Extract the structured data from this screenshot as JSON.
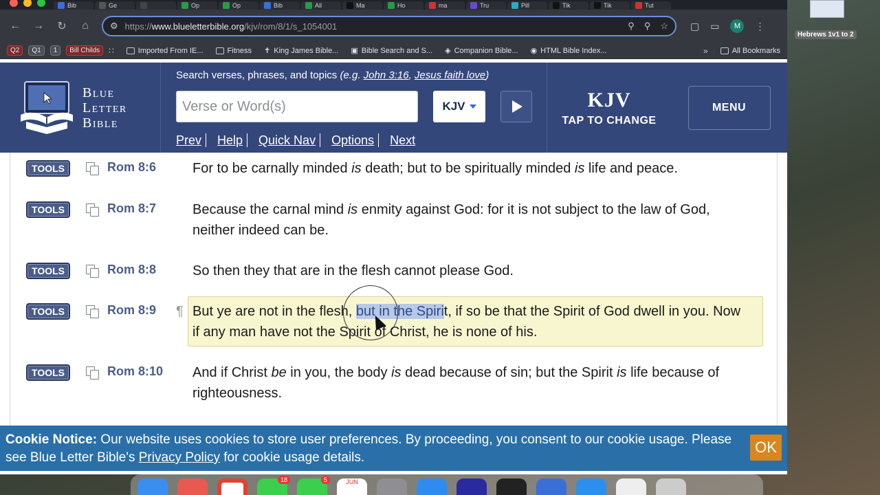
{
  "browser": {
    "tabs": [
      {
        "label": "Bib",
        "color": "#3a6fd8"
      },
      {
        "label": "Ge",
        "color": "#555"
      },
      {
        "label": "",
        "color": "#444"
      },
      {
        "label": "Op",
        "color": "#2a9a4a"
      },
      {
        "label": "Op",
        "color": "#2a9a4a"
      },
      {
        "label": "Bib",
        "color": "#3a6fd8"
      },
      {
        "label": "All",
        "color": "#2a9a4a"
      },
      {
        "label": "Ma",
        "color": "#111"
      },
      {
        "label": "Ho",
        "color": "#2a9a4a"
      },
      {
        "label": "ma",
        "color": "#c33"
      },
      {
        "label": "Tru",
        "color": "#6a4ac8"
      },
      {
        "label": "Pill",
        "color": "#2aa8c8"
      },
      {
        "label": "Tik",
        "color": "#111"
      },
      {
        "label": "Tik",
        "color": "#111"
      },
      {
        "label": "Tut",
        "color": "#c33"
      }
    ],
    "url_prefix": "https://",
    "url_domain": "www.blueletterbible.org",
    "url_path": "/kjv/rom/8/1/s_1054001",
    "avatar_letter": "M",
    "bookmark_chips": [
      "Q2",
      "Q1",
      "1",
      "Bill Childs"
    ],
    "bookmarks": [
      "Imported From IE...",
      "Fitness",
      "King James Bible...",
      "Bible Search and S...",
      "Companion Bible...",
      "HTML Bible Index..."
    ],
    "all_bookmarks": "All Bookmarks"
  },
  "header": {
    "logo_line1": "Blue",
    "logo_line2": "Letter",
    "logo_line3": "Bible",
    "search_hint_prefix": "Search verses, phrases, and topics ",
    "search_hint_eg": "(e.g. ",
    "search_example1": "John 3:16",
    "search_example_sep": ", ",
    "search_example2": "Jesus faith love",
    "search_hint_close": ")",
    "search_placeholder": "Verse or Word(s)",
    "version": "KJV",
    "nav": [
      "Prev",
      "Help",
      "Quick Nav",
      "Options",
      "Next"
    ],
    "version_big": "KJV",
    "version_tap": "TAP TO CHANGE",
    "menu_label": "MENU"
  },
  "verses": [
    {
      "ref": "Rom 8:6",
      "tools": "TOOLS",
      "html_parts": [
        "For to be carnally minded ",
        "is",
        " death; but to be spiritually minded ",
        "is",
        " life and peace."
      ]
    },
    {
      "ref": "Rom 8:7",
      "tools": "TOOLS",
      "html_parts": [
        "Because the carnal mind ",
        "is",
        " enmity against God: for it is not subject to the law of God, neither indeed can be."
      ]
    },
    {
      "ref": "Rom 8:8",
      "tools": "TOOLS",
      "html_parts": [
        "So then they that are in the flesh cannot please God."
      ]
    },
    {
      "ref": "Rom 8:9",
      "tools": "TOOLS",
      "pilcrow": "¶",
      "before": "But ye are not in the flesh, ",
      "selected": "but in the Spiri",
      "after": "t, if so be that the Spirit of God dwell in you. Now if any man have not the Spirit of Christ, he is none of his."
    },
    {
      "ref": "Rom 8:10",
      "tools": "TOOLS",
      "html_parts": [
        "And if Christ ",
        "be",
        " in you, the body ",
        "is",
        " dead because of sin; but the Spirit ",
        "is",
        " life because of righteousness."
      ]
    }
  ],
  "cookie": {
    "title": "Cookie Notice:",
    "text1": " Our website uses cookies to store user preferences. By proceeding, you consent to our cookie usage. Please see Blue Letter Bible's ",
    "link": "Privacy Policy",
    "text2": " for cookie usage details.",
    "ok": "OK"
  },
  "desktop": {
    "window_label": "Hebrews 1v1 to 2",
    "dock_badges": [
      "18",
      "5"
    ],
    "calendar_month": "JUN"
  }
}
